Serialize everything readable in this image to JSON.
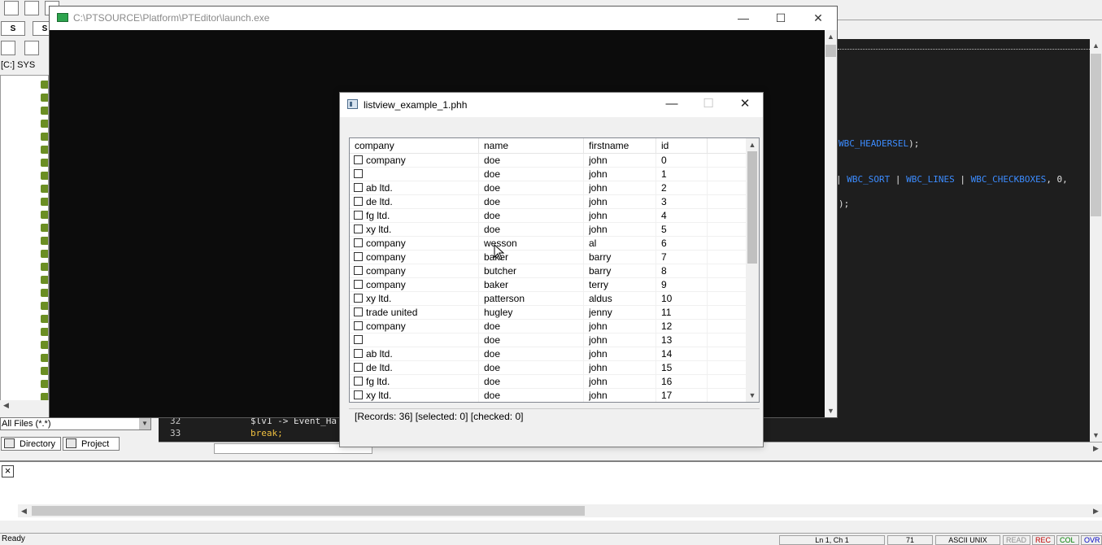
{
  "ide": {
    "left_tabs": [
      "S",
      "S"
    ],
    "drive_label": "[C:] SYS",
    "file_filter": "All Files (*.*)",
    "bottom_tabs": [
      "Directory",
      "Project"
    ],
    "code_lines": [
      {
        "no": "32",
        "text": "$lv1 -> Event_Ha"
      },
      {
        "no": "33",
        "text": "break;"
      }
    ],
    "code_fragments": {
      "headersel": "WBC_HEADERSEL",
      "headersel_tail": ");",
      "flags_sep1": "| ",
      "flag_sort": "WBC_SORT",
      "flags_sep2": " | ",
      "flag_lines": "WBC_LINES",
      "flags_sep3": " | ",
      "flag_checkboxes": "WBC_CHECKBOXES",
      "flags_tail": ", 0,",
      "close_paren": ");"
    },
    "status": {
      "ready": "Ready",
      "position": "Ln 1, Ch 1",
      "col": "71",
      "encoding": "ASCII UNIX",
      "read": "READ",
      "rec": "REC",
      "col_ind": "COL",
      "ovr": "OVR"
    }
  },
  "console": {
    "title": "C:\\PTSOURCE\\Platform\\PTEditor\\launch.exe"
  },
  "dialog": {
    "title": "listview_example_1.phh",
    "columns": [
      "company",
      "name",
      "firstname",
      "id"
    ],
    "rows": [
      {
        "company": "company",
        "name": "doe",
        "firstname": "john",
        "id": "0"
      },
      {
        "company": "",
        "name": "doe",
        "firstname": "john",
        "id": "1"
      },
      {
        "company": "ab ltd.",
        "name": "doe",
        "firstname": "john",
        "id": "2"
      },
      {
        "company": "de ltd.",
        "name": "doe",
        "firstname": "john",
        "id": "3"
      },
      {
        "company": "fg ltd.",
        "name": "doe",
        "firstname": "john",
        "id": "4"
      },
      {
        "company": "xy ltd.",
        "name": "doe",
        "firstname": "john",
        "id": "5"
      },
      {
        "company": "company",
        "name": "wesson",
        "firstname": "al",
        "id": "6"
      },
      {
        "company": "company",
        "name": "baker",
        "firstname": "barry",
        "id": "7"
      },
      {
        "company": "company",
        "name": "butcher",
        "firstname": "barry",
        "id": "8"
      },
      {
        "company": "company",
        "name": "baker",
        "firstname": "terry",
        "id": "9"
      },
      {
        "company": "xy ltd.",
        "name": "patterson",
        "firstname": "aldus",
        "id": "10"
      },
      {
        "company": "trade united",
        "name": "hugley",
        "firstname": "jenny",
        "id": "11"
      },
      {
        "company": "company",
        "name": "doe",
        "firstname": "john",
        "id": "12"
      },
      {
        "company": "",
        "name": "doe",
        "firstname": "john",
        "id": "13"
      },
      {
        "company": "ab ltd.",
        "name": "doe",
        "firstname": "john",
        "id": "14"
      },
      {
        "company": "de ltd.",
        "name": "doe",
        "firstname": "john",
        "id": "15"
      },
      {
        "company": "fg ltd.",
        "name": "doe",
        "firstname": "john",
        "id": "16"
      },
      {
        "company": "xy ltd.",
        "name": "doe",
        "firstname": "john",
        "id": "17"
      }
    ],
    "status_text": "[Records: 36]  [selected: 0]  [checked: 0]"
  }
}
